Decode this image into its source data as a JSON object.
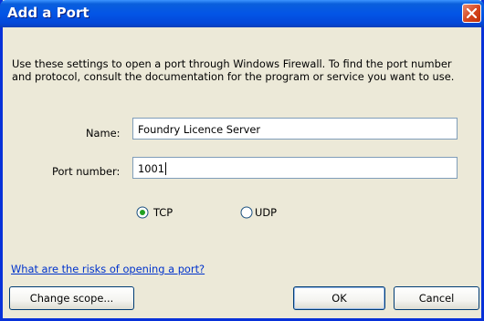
{
  "dialog": {
    "title": "Add a Port",
    "description": "Use these settings to open a port through Windows Firewall. To find the port number and protocol, consult the documentation for the program or service you want to use."
  },
  "fields": {
    "name_label": "Name:",
    "name_value": "Foundry Licence Server",
    "port_label": "Port number:",
    "port_value": "1001"
  },
  "protocol": {
    "selected": "TCP",
    "options": [
      "TCP",
      "UDP"
    ]
  },
  "link_text": "What are the risks of opening a port?",
  "buttons": {
    "change_scope": "Change scope...",
    "ok": "OK",
    "cancel": "Cancel"
  },
  "colors": {
    "titlebar": "#0355e6",
    "dialog_bg": "#ece9d8",
    "link": "#0033cc",
    "close": "#d5441d"
  },
  "icons": {
    "close": "close-icon",
    "radio_selected": "radio-selected-icon",
    "radio_unselected": "radio-unselected-icon"
  }
}
